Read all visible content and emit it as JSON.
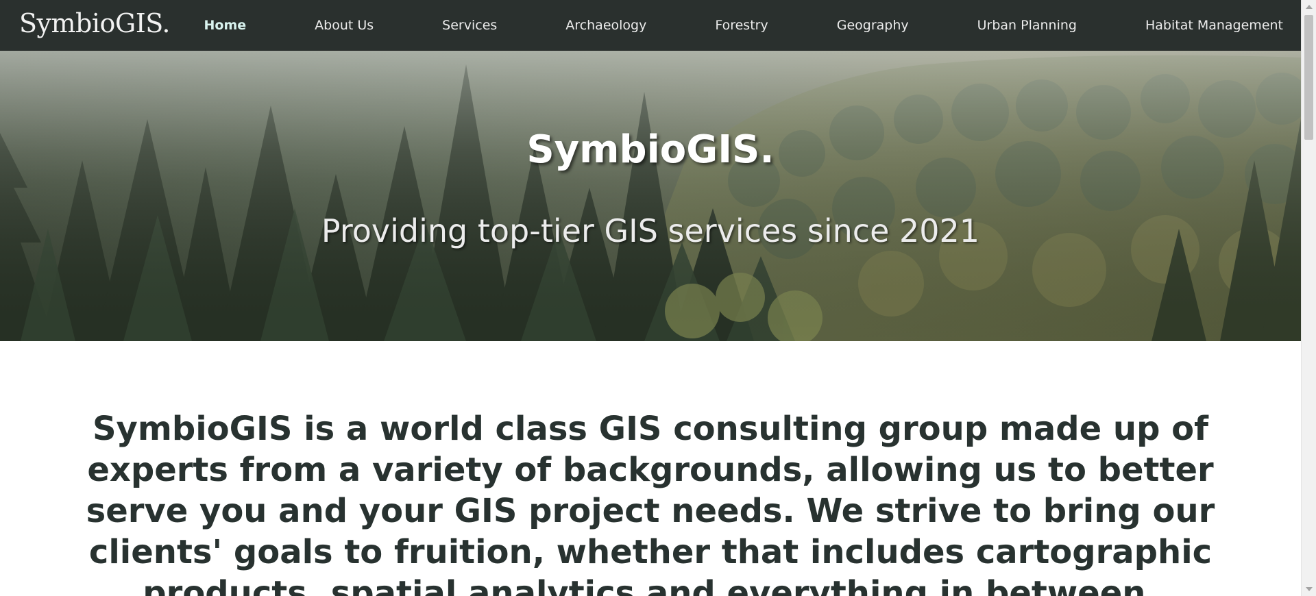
{
  "brand": "SymbioGIS.",
  "nav": {
    "items": [
      {
        "label": "Home",
        "active": true
      },
      {
        "label": "About Us",
        "active": false
      },
      {
        "label": "Services",
        "active": false
      },
      {
        "label": "Archaeology",
        "active": false
      },
      {
        "label": "Forestry",
        "active": false
      },
      {
        "label": "Geography",
        "active": false
      },
      {
        "label": "Urban Planning",
        "active": false
      },
      {
        "label": "Habitat Management",
        "active": false
      }
    ]
  },
  "hero": {
    "title": "SymbioGIS.",
    "subtitle": "Providing top-tier GIS services since 2021",
    "background_image": "misty-forest"
  },
  "intro": {
    "text": "SymbioGIS is a world class GIS consulting group made up of experts from a variety of backgrounds, allowing us to better serve you and your GIS project needs. We strive to bring our clients' goals to fruition, whether that includes cartographic products, spatial analytics and everything in between."
  },
  "colors": {
    "nav_background": "#2a302e",
    "nav_active": "#d9f3ef",
    "intro_text": "#283230"
  }
}
